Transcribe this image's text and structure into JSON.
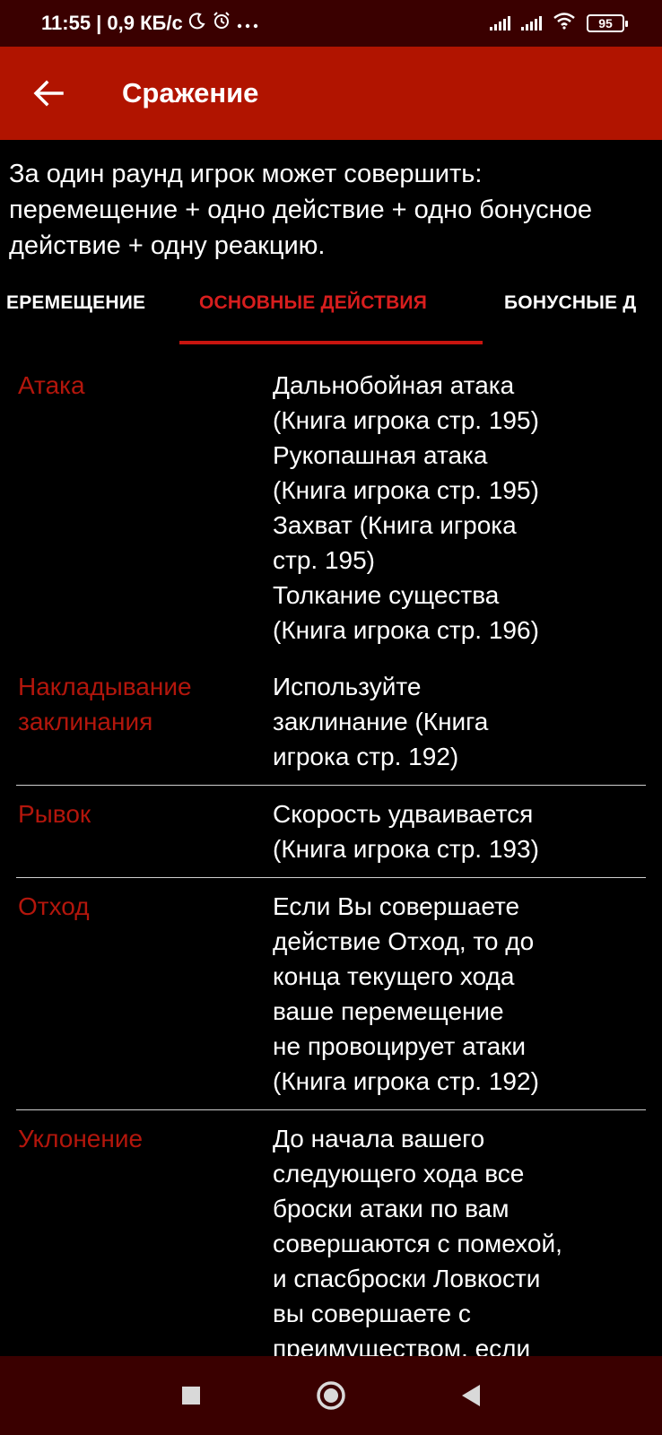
{
  "status_bar": {
    "time_speed": "11:55 | 0,9 КБ/с",
    "battery": "95"
  },
  "app_bar": {
    "title": "Сражение"
  },
  "intro": "За один раунд игрок может совершить: перемещение + одно действие + одно бонусное действие + одну реакцию.",
  "tabs": [
    {
      "label": "ЕРЕМЕЩЕНИЕ"
    },
    {
      "label": "ОСНОВНЫЕ ДЕЙСТВИЯ"
    },
    {
      "label": "БОНУСНЫЕ Д"
    }
  ],
  "actions": [
    {
      "name": "Атака",
      "desc": "Дальнобойная атака\n(Книга игрока стр. 195)\nРукопашная атака\n(Книга игрока стр. 195)\nЗахват (Книга игрока\nстр. 195)\nТолкание существа\n(Книга игрока стр. 196)"
    },
    {
      "name": "Накладывание заклинания",
      "desc": "Используйте\nзаклинание (Книга\nигрока стр. 192)"
    },
    {
      "name": "Рывок",
      "desc": "Скорость удваивается\n(Книга игрока стр. 193)"
    },
    {
      "name": "Отход",
      "desc": "Если Вы совершаете\nдействие Отход, то до\nконца текущего хода\nваше перемещение\nне провоцирует атаки\n(Книга игрока стр. 192)"
    },
    {
      "name": "Уклонение",
      "desc": "До начала вашего\nследующего хода все\nброски атаки по вам\nсовершаются с помехой,\nи спасброски Ловкости\nвы совершаете с\nпреимуществом, если"
    }
  ],
  "colors": {
    "app_bar": "#b11400",
    "status_bar": "#3a0000",
    "accent": "#c8150f",
    "action_name": "#b3160c"
  }
}
